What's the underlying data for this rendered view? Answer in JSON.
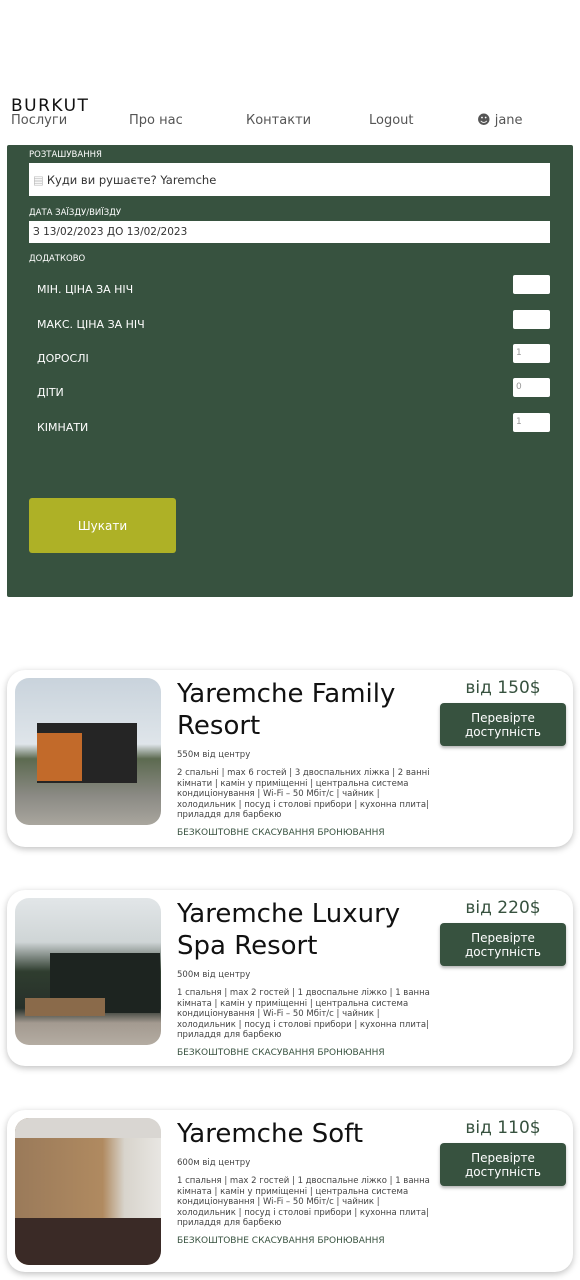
{
  "header": {
    "logo": "BURKUT",
    "nav": [
      "Послуги",
      "Про нас",
      "Контакти",
      "Logout"
    ],
    "user": "jane"
  },
  "search": {
    "location_label": "РОЗТАШУВАННЯ",
    "location_value": "Куди ви рушаєте? Yaremche",
    "dates_label": "ДАТА ЗАЇЗДУ/ВИЇЗДУ",
    "dates_value": "З 13/02/2023 ДО 13/02/2023",
    "extra_label": "ДОДАТКОВО",
    "fields": [
      {
        "label": "МІН. ЦІНА ЗА НІЧ",
        "value": ""
      },
      {
        "label": "МАКС. ЦІНА ЗА НІЧ",
        "value": ""
      },
      {
        "label": "ДОРОСЛІ",
        "value": "1"
      },
      {
        "label": "ДІТИ",
        "value": "0"
      },
      {
        "label": "КІМНАТИ",
        "value": "1"
      }
    ],
    "button": "Шукати"
  },
  "results": [
    {
      "title": "Yaremche Family Resort",
      "distance": "550м від центру",
      "description": "2 спальні | max 6 гостей | 3 двоспальних ліжка | 2 ванні кімнати | камін у приміщенні | центральна система кондиціонування | Wi-Fi – 50 Мбіт/с | чайник | холодильник | посуд і столові прибори | кухонна плита| приладдя для барбекю",
      "cancellation": "БЕЗКОШТОВНЕ СКАСУВАННЯ БРОНЮВАННЯ",
      "price": "від 150$",
      "button": "Перевірте доступність"
    },
    {
      "title": "Yaremche Luxury Spa Resort",
      "distance": "500м від центру",
      "description": "1 спальня | max 2 гостей | 1 двоспальне ліжко | 1 ванна кімната | камін у приміщенні | центральна система кондиціонування | Wi-Fi – 50 Мбіт/с | чайник | холодильник | посуд і столові прибори | кухонна плита| приладдя для барбекю",
      "cancellation": "БЕЗКОШТОВНЕ СКАСУВАННЯ БРОНЮВАННЯ",
      "price": "від 220$",
      "button": "Перевірте доступність"
    },
    {
      "title": "Yaremche Soft",
      "distance": "600м від центру",
      "description": "1 спальня | max 2 гостей | 1 двоспальне ліжко | 1 ванна кімната | камін у приміщенні | центральна система кондиціонування | Wi-Fi – 50 Мбіт/с | чайник | холодильник | посуд і столові прибори | кухонна плита| приладдя для барбекю",
      "cancellation": "БЕЗКОШТОВНЕ СКАСУВАННЯ БРОНЮВАННЯ",
      "price": "від 110$",
      "button": "Перевірте доступність"
    }
  ],
  "colors": {
    "primary": "#37523f",
    "accent": "#aeb126"
  }
}
